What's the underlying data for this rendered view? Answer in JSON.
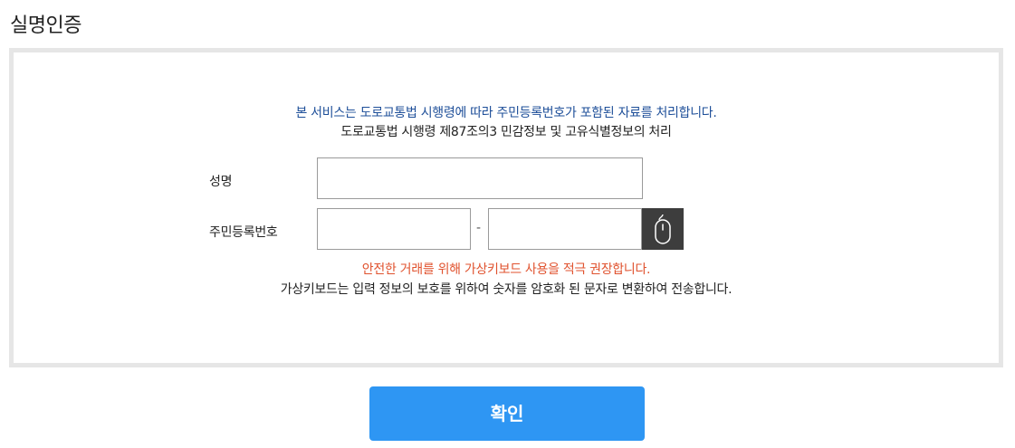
{
  "page": {
    "title": "실명인증"
  },
  "notices": {
    "service": "본 서비스는 도로교통법 시행령에 따라 주민등록번호가 포함된 자료를 처리합니다.",
    "legal_basis": "도로교통법 시행령 제87조의3 민감정보 및 고유식별정보의 처리",
    "virtual_keyboard_recommend": "안전한 거래를 위해 가상키보드 사용을 적극 권장합니다.",
    "virtual_keyboard_encrypt": "가상키보드는 입력 정보의 보호를 위하여 숫자를 암호화 된 문자로 변환하여 전송합니다."
  },
  "form": {
    "name_label": "성명",
    "name_value": "",
    "rrn_label": "주민등록번호",
    "rrn_front_value": "",
    "rrn_separator": "-",
    "rrn_back_value": "",
    "virtual_keyboard_icon": "mouse-icon"
  },
  "actions": {
    "confirm_label": "확인"
  },
  "colors": {
    "notice_blue": "#1e4f99",
    "notice_red": "#e0522e",
    "confirm_button": "#2e96f3",
    "keyboard_button": "#3d3d3d",
    "box_border": "#e6e6e6"
  }
}
